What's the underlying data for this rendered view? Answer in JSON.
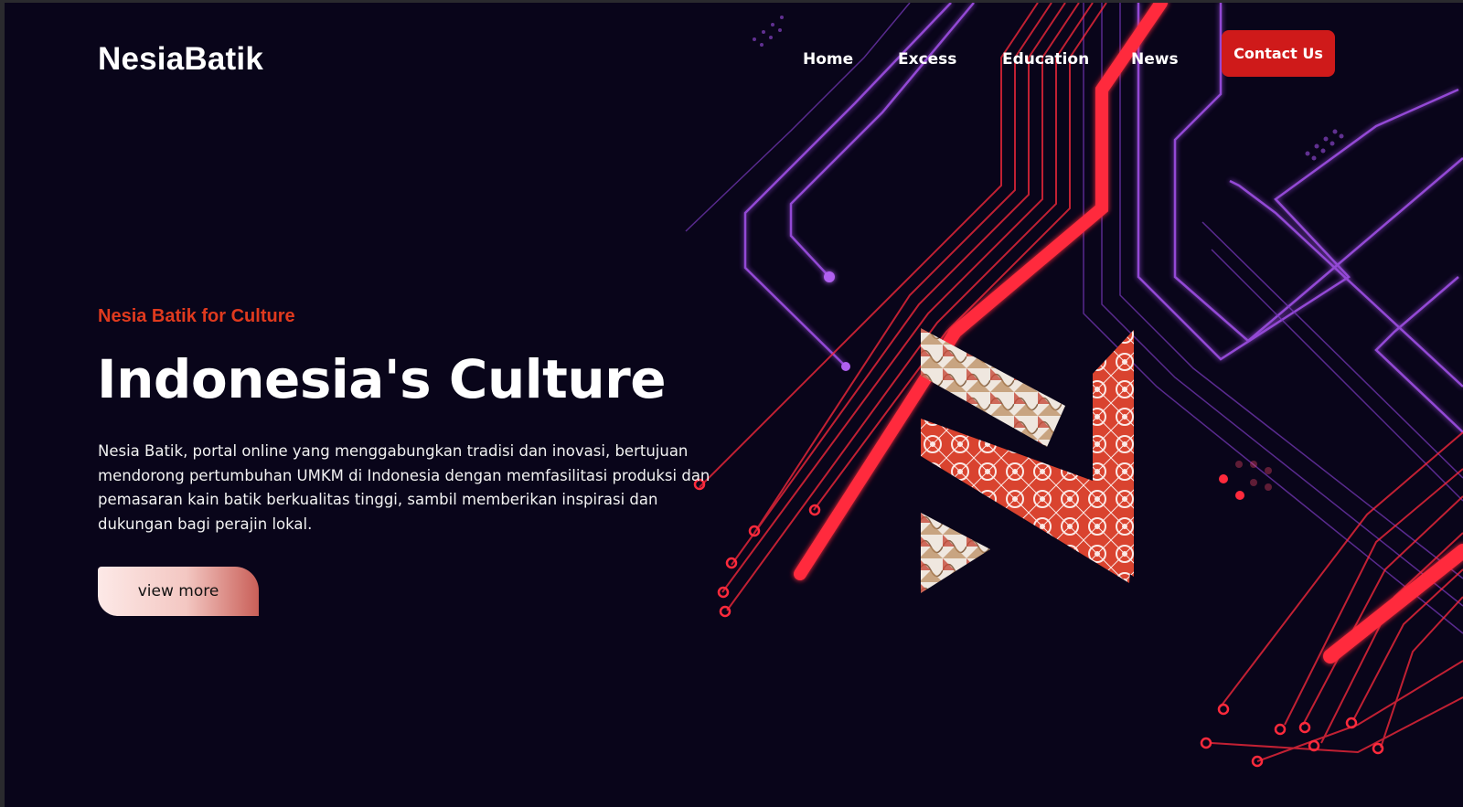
{
  "brand": {
    "name": "NesiaBatik"
  },
  "nav": {
    "items": [
      "Home",
      "Excess",
      "Education",
      "News"
    ],
    "contact_label": "Contact Us"
  },
  "hero": {
    "eyebrow": "Nesia Batik for Culture",
    "title": "Indonesia's Culture",
    "description": "Nesia Batik, portal online yang menggabungkan tradisi dan inovasi, bertujuan mendorong pertumbuhan UMKM di Indonesia dengan memfasilitasi produksi dan pemasaran kain batik berkualitas tinggi, sambil memberikan inspirasi dan dukungan bagi perajin lokal.",
    "button_label": "view more"
  },
  "colors": {
    "background": "#09051a",
    "accent_red": "#cf1a1a",
    "eyebrow": "#e03a1e",
    "circuit_purple": "#9b4de0",
    "circuit_red": "#ff2a3c"
  },
  "icons": [
    "circuit-background",
    "batik-n-logo-mark"
  ]
}
